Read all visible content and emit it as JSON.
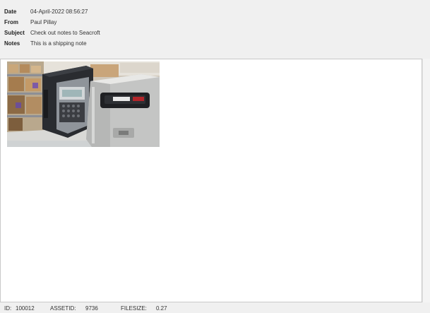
{
  "header": {
    "date": {
      "label": "Date",
      "value": "04-April-2022 08:56:27"
    },
    "from": {
      "label": "From",
      "value": "Paul Pillay"
    },
    "subject": {
      "label": "Subject",
      "value": "Check out notes to Seacroft"
    },
    "notes": {
      "label": "Notes",
      "value": "This is a shipping note"
    }
  },
  "attachment": {
    "icon": "photo-thumbnail"
  },
  "footer": {
    "id_label": "ID:",
    "id_value": "100012",
    "assetid_label": "ASSETID:",
    "assetid_value": "9736",
    "filesize_label": "FILESIZE:",
    "filesize_value": "0.27"
  }
}
